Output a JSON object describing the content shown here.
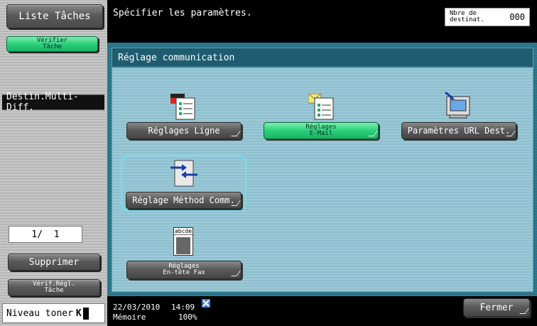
{
  "left_panel": {
    "liste_taches": "Liste Tâches",
    "verifier_tache_1": "Vérifier",
    "verifier_tache_2": "Tâche",
    "destin_multi_diff": "Destin.Multi-Diff.",
    "counter": "1/  1",
    "supprimer": "Supprimer",
    "verif_regl_1": "Vérif.Régl.",
    "verif_regl_2": "Tâche",
    "toner_label": "Niveau toner",
    "toner_k": "K"
  },
  "header": {
    "message": "Spécifier les paramètres.",
    "dest_label_1": "Nbre de",
    "dest_label_2": "destinat.",
    "dest_count": "000"
  },
  "panel": {
    "title": "Réglage communication",
    "items": [
      {
        "label": "Réglages Ligne",
        "icon": "line-settings-icon"
      },
      {
        "label_1": "Réglages",
        "label_2": "E-Mail",
        "icon": "email-settings-icon",
        "selected_style": "green"
      },
      {
        "label": "Paramètres URL Dest.",
        "icon": "url-dest-icon"
      },
      {
        "label": "Réglage Méthod Comm.",
        "icon": "comm-method-icon"
      },
      {
        "label_1": "Réglages",
        "label_2": "En-tête Fax",
        "icon": "fax-header-icon",
        "icon_text": "abcde"
      }
    ]
  },
  "footer": {
    "date": "22/03/2010",
    "time": "14:09",
    "memory_label": "Mémoire",
    "memory_value": "100%",
    "fermer": "Fermer",
    "network_icon": "network-icon"
  },
  "colors": {
    "accent_green": "#2bcf79",
    "panel_teal": "#2f7c93",
    "inner_blue": "#9cc9d7",
    "selection_cyan": "#6fe0f0"
  }
}
